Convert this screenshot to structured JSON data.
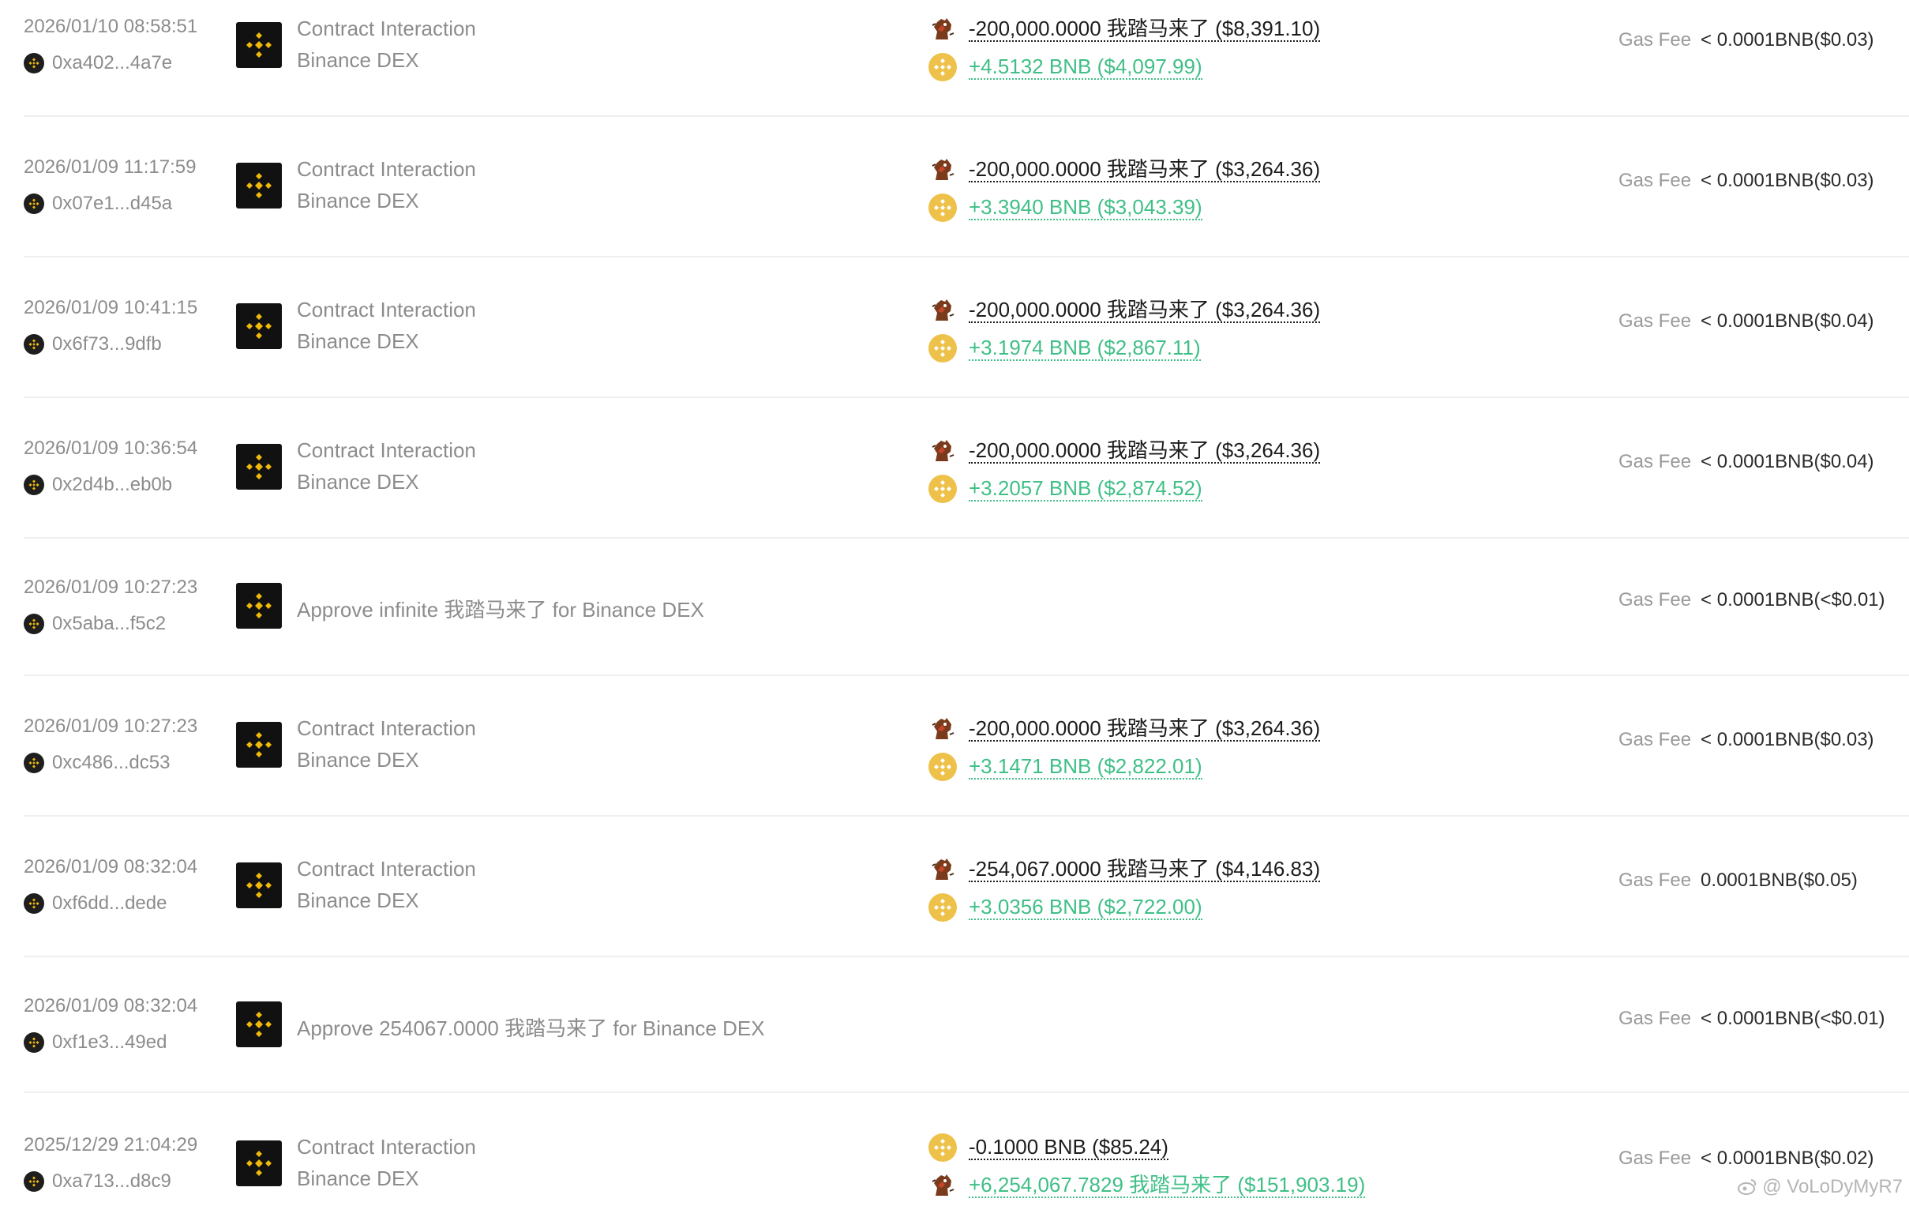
{
  "colors": {
    "positive": "#3fbf86",
    "negative": "#1c1c1c",
    "bnb_gold": "#f0b90b",
    "bnb_coin": "#eec24a"
  },
  "rows": [
    {
      "date": "2026/01/10 08:58:51",
      "hash": "0xa402...4a7e",
      "type_line1": "Contract Interaction",
      "type_line2": "Binance DEX",
      "amount1": "-200,000.0000 我踏马来了 ($8,391.10)",
      "amount2": "+4.5132 BNB ($4,097.99)",
      "gas_label": "Gas Fee",
      "gas_value": "< 0.0001BNB($0.03)"
    },
    {
      "date": "2026/01/09 11:17:59",
      "hash": "0x07e1...d45a",
      "type_line1": "Contract Interaction",
      "type_line2": "Binance DEX",
      "amount1": "-200,000.0000 我踏马来了 ($3,264.36)",
      "amount2": "+3.3940 BNB ($3,043.39)",
      "gas_label": "Gas Fee",
      "gas_value": "< 0.0001BNB($0.03)"
    },
    {
      "date": "2026/01/09 10:41:15",
      "hash": "0x6f73...9dfb",
      "type_line1": "Contract Interaction",
      "type_line2": "Binance DEX",
      "amount1": "-200,000.0000 我踏马来了 ($3,264.36)",
      "amount2": "+3.1974 BNB ($2,867.11)",
      "gas_label": "Gas Fee",
      "gas_value": "< 0.0001BNB($0.04)"
    },
    {
      "date": "2026/01/09 10:36:54",
      "hash": "0x2d4b...eb0b",
      "type_line1": "Contract Interaction",
      "type_line2": "Binance DEX",
      "amount1": "-200,000.0000 我踏马来了 ($3,264.36)",
      "amount2": "+3.2057 BNB ($2,874.52)",
      "gas_label": "Gas Fee",
      "gas_value": "< 0.0001BNB($0.04)"
    },
    {
      "date": "2026/01/09 10:27:23",
      "hash": "0x5aba...f5c2",
      "type_single": "Approve infinite 我踏马来了 for Binance DEX",
      "gas_label": "Gas Fee",
      "gas_value": "< 0.0001BNB(<$0.01)"
    },
    {
      "date": "2026/01/09 10:27:23",
      "hash": "0xc486...dc53",
      "type_line1": "Contract Interaction",
      "type_line2": "Binance DEX",
      "amount1": "-200,000.0000 我踏马来了 ($3,264.36)",
      "amount2": "+3.1471 BNB ($2,822.01)",
      "gas_label": "Gas Fee",
      "gas_value": "< 0.0001BNB($0.03)"
    },
    {
      "date": "2026/01/09 08:32:04",
      "hash": "0xf6dd...dede",
      "type_line1": "Contract Interaction",
      "type_line2": "Binance DEX",
      "amount1": "-254,067.0000 我踏马来了 ($4,146.83)",
      "amount2": "+3.0356 BNB ($2,722.00)",
      "gas_label": "Gas Fee",
      "gas_value": "0.0001BNB($0.05)"
    },
    {
      "date": "2026/01/09 08:32:04",
      "hash": "0xf1e3...49ed",
      "type_single": "Approve 254067.0000 我踏马来了 for Binance DEX",
      "gas_label": "Gas Fee",
      "gas_value": "< 0.0001BNB(<$0.01)"
    },
    {
      "date": "2025/12/29 21:04:29",
      "hash": "0xa713...d8c9",
      "type_line1": "Contract Interaction",
      "type_line2": "Binance DEX",
      "amount1": "-0.1000 BNB ($85.24)",
      "amount2": "+6,254,067.7829 我踏马来了 ($151,903.19)",
      "gas_label": "Gas Fee",
      "gas_value": "< 0.0001BNB($0.02)"
    }
  ],
  "watermark": "@ VoLoDyMyR7"
}
